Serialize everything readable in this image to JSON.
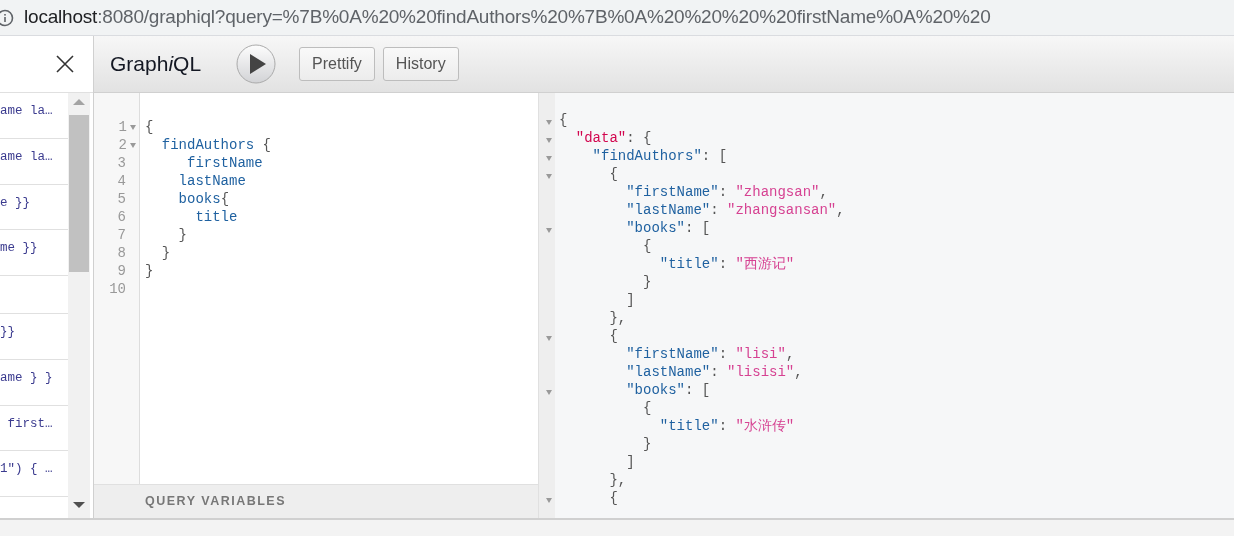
{
  "address_bar": {
    "host": "localhost",
    "rest": ":8080/graphiql?query=%7B%0A%20%20findAuthors%20%7B%0A%20%20%20%20firstName%0A%20%20"
  },
  "history": {
    "items": [
      {
        "kind": "query",
        "text": "ame la…"
      },
      {
        "kind": "query",
        "text": "ame la…"
      },
      {
        "kind": "query",
        "text": "e }}"
      },
      {
        "kind": "query",
        "text": "me }}"
      },
      {
        "kind": "empty"
      },
      {
        "kind": "query",
        "text": "}}"
      },
      {
        "kind": "query",
        "text": "ame } }"
      },
      {
        "kind": "query",
        "text": " first…"
      },
      {
        "kind": "query",
        "text": "1\") { …"
      }
    ]
  },
  "toolbar": {
    "title": [
      {
        "text": "Graph",
        "italic": false
      },
      {
        "text": "i",
        "italic": true
      },
      {
        "text": "QL",
        "italic": false
      }
    ],
    "buttons": [
      "Prettify",
      "History"
    ]
  },
  "query_editor": {
    "lines": [
      {
        "number": "1",
        "fold": true,
        "tokens": [
          {
            "text": "{",
            "kind": "punct"
          }
        ]
      },
      {
        "number": "2",
        "fold": true,
        "tokens": [
          {
            "text": "  findAuthors",
            "kind": "field"
          },
          {
            "text": " {",
            "kind": "punct"
          }
        ]
      },
      {
        "number": "3",
        "fold": false,
        "tokens": [
          {
            "text": "     firstName",
            "kind": "field"
          }
        ]
      },
      {
        "number": "4",
        "fold": false,
        "tokens": [
          {
            "text": "    lastName",
            "kind": "field"
          }
        ]
      },
      {
        "number": "5",
        "fold": false,
        "tokens": [
          {
            "text": "    books",
            "kind": "field"
          },
          {
            "text": "{",
            "kind": "punct"
          }
        ]
      },
      {
        "number": "6",
        "fold": false,
        "tokens": [
          {
            "text": "      title",
            "kind": "field"
          }
        ]
      },
      {
        "number": "7",
        "fold": false,
        "tokens": [
          {
            "text": "    }",
            "kind": "punct"
          }
        ]
      },
      {
        "number": "8",
        "fold": false,
        "tokens": [
          {
            "text": "  }",
            "kind": "punct"
          }
        ]
      },
      {
        "number": "9",
        "fold": false,
        "tokens": [
          {
            "text": "}",
            "kind": "punct"
          }
        ]
      },
      {
        "number": "10",
        "fold": false
      }
    ],
    "variables_label": "QUERY VARIABLES"
  },
  "result": {
    "lines": [
      {
        "fold": true,
        "tokens": [
          {
            "text": "{",
            "kind": "punct"
          }
        ]
      },
      {
        "fold": true,
        "tokens": [
          {
            "text": "  \"data\"",
            "kind": "def"
          },
          {
            "text": ": {",
            "kind": "punct"
          }
        ]
      },
      {
        "fold": true,
        "tokens": [
          {
            "text": "    \"findAuthors\"",
            "kind": "key"
          },
          {
            "text": ": [",
            "kind": "punct"
          }
        ]
      },
      {
        "fold": true,
        "tokens": [
          {
            "text": "      {",
            "kind": "punct"
          }
        ]
      },
      {
        "fold": false,
        "tokens": [
          {
            "text": "        \"firstName\"",
            "kind": "key"
          },
          {
            "text": ": ",
            "kind": "punct"
          },
          {
            "text": "\"zhangsan\"",
            "kind": "string"
          },
          {
            "text": ",",
            "kind": "punct"
          }
        ]
      },
      {
        "fold": false,
        "tokens": [
          {
            "text": "        \"lastName\"",
            "kind": "key"
          },
          {
            "text": ": ",
            "kind": "punct"
          },
          {
            "text": "\"zhangsansan\"",
            "kind": "string"
          },
          {
            "text": ",",
            "kind": "punct"
          }
        ]
      },
      {
        "fold": true,
        "tokens": [
          {
            "text": "        \"books\"",
            "kind": "key"
          },
          {
            "text": ": [",
            "kind": "punct"
          }
        ]
      },
      {
        "fold": false,
        "tokens": [
          {
            "text": "          {",
            "kind": "punct"
          }
        ]
      },
      {
        "fold": false,
        "tokens": [
          {
            "text": "            \"title\"",
            "kind": "key"
          },
          {
            "text": ": ",
            "kind": "punct"
          },
          {
            "text": "\"西游记\"",
            "kind": "string"
          }
        ]
      },
      {
        "fold": false,
        "tokens": [
          {
            "text": "          }",
            "kind": "punct"
          }
        ]
      },
      {
        "fold": false,
        "tokens": [
          {
            "text": "        ]",
            "kind": "punct"
          }
        ]
      },
      {
        "fold": false,
        "tokens": [
          {
            "text": "      },",
            "kind": "punct"
          }
        ]
      },
      {
        "fold": true,
        "tokens": [
          {
            "text": "      {",
            "kind": "punct"
          }
        ]
      },
      {
        "fold": false,
        "tokens": [
          {
            "text": "        \"firstName\"",
            "kind": "key"
          },
          {
            "text": ": ",
            "kind": "punct"
          },
          {
            "text": "\"lisi\"",
            "kind": "string"
          },
          {
            "text": ",",
            "kind": "punct"
          }
        ]
      },
      {
        "fold": false,
        "tokens": [
          {
            "text": "        \"lastName\"",
            "kind": "key"
          },
          {
            "text": ": ",
            "kind": "punct"
          },
          {
            "text": "\"lisisi\"",
            "kind": "string"
          },
          {
            "text": ",",
            "kind": "punct"
          }
        ]
      },
      {
        "fold": true,
        "tokens": [
          {
            "text": "        \"books\"",
            "kind": "key"
          },
          {
            "text": ": [",
            "kind": "punct"
          }
        ]
      },
      {
        "fold": false,
        "tokens": [
          {
            "text": "          {",
            "kind": "punct"
          }
        ]
      },
      {
        "fold": false,
        "tokens": [
          {
            "text": "            \"title\"",
            "kind": "key"
          },
          {
            "text": ": ",
            "kind": "punct"
          },
          {
            "text": "\"水浒传\"",
            "kind": "string"
          }
        ]
      },
      {
        "fold": false,
        "tokens": [
          {
            "text": "          }",
            "kind": "punct"
          }
        ]
      },
      {
        "fold": false,
        "tokens": [
          {
            "text": "        ]",
            "kind": "punct"
          }
        ]
      },
      {
        "fold": false,
        "tokens": [
          {
            "text": "      },",
            "kind": "punct"
          }
        ]
      },
      {
        "fold": true,
        "tokens": [
          {
            "text": "      {",
            "kind": "punct"
          }
        ]
      }
    ]
  }
}
